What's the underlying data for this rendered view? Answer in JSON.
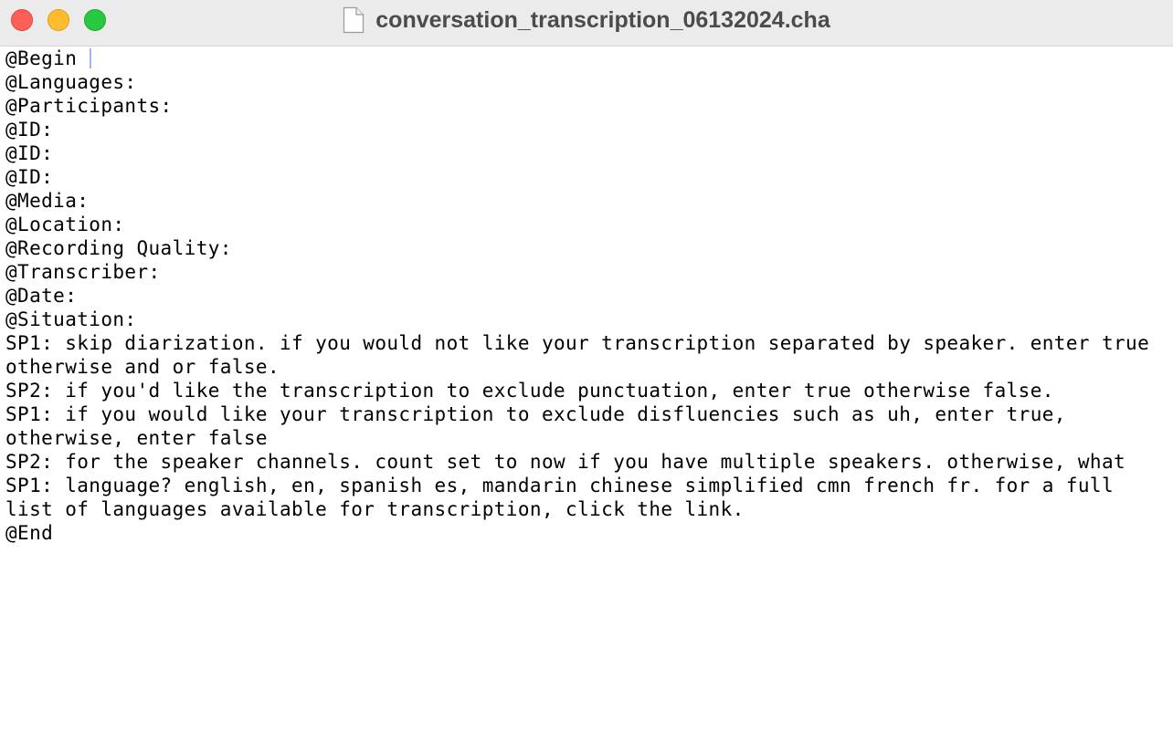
{
  "window": {
    "title": "conversation_transcription_06132024.cha",
    "controls": {
      "close": "close-button",
      "minimize": "minimize-button",
      "zoom": "zoom-button"
    },
    "title_icon": "document-icon"
  },
  "colors": {
    "close": "#ff5f57",
    "minimize": "#febc2e",
    "zoom": "#28c840",
    "titlebar": "#ebebeb",
    "caret": "#9fb8f4"
  },
  "document": {
    "lines": [
      "@Begin ",
      "@Languages:",
      "@Participants:",
      "@ID:",
      "@ID:",
      "@ID:",
      "@Media:",
      "@Location:",
      "@Recording Quality:",
      "@Transcriber:",
      "@Date:",
      "@Situation:",
      "SP1: skip diarization. if you would not like your transcription separated by speaker. enter true",
      "otherwise and or false.",
      "SP2: if you'd like the transcription to exclude punctuation, enter true otherwise false.",
      "SP1: if you would like your transcription to exclude disfluencies such as uh, enter true,",
      "otherwise, enter false",
      "SP2: for the speaker channels. count set to now if you have multiple speakers. otherwise, what",
      "SP1: language? english, en, spanish es, mandarin chinese simplified cmn french fr. for a full",
      "list of languages available for transcription, click the link.",
      "@End"
    ]
  }
}
